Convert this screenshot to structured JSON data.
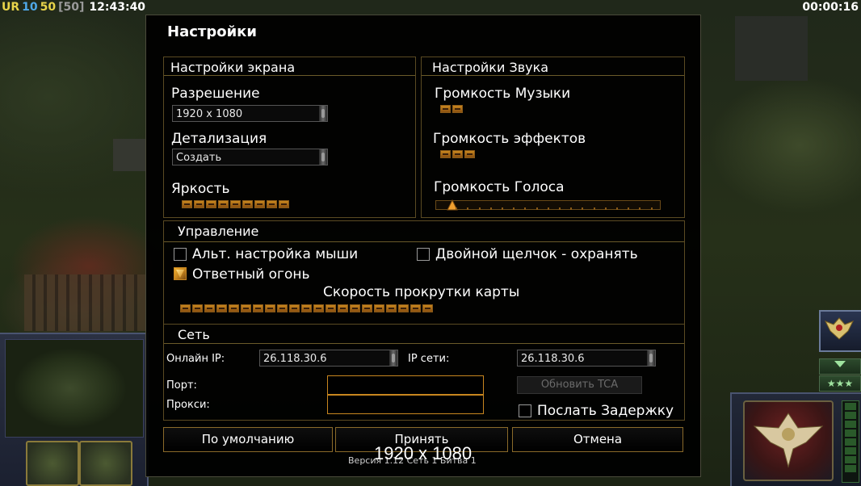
{
  "hud": {
    "ur": "UR",
    "level": "10",
    "count_a": "50",
    "count_b": "[50]",
    "clock": "12:43:40",
    "timer": "00:00:16"
  },
  "dialog": {
    "title": "Настройки",
    "screen": {
      "title": "Настройки экрана",
      "resolution_label": "Разрешение",
      "resolution_value": "1920 x 1080",
      "detail_label": "Детализация",
      "detail_value": "Создать",
      "brightness_label": "Яркость",
      "brightness_segments": 9
    },
    "sound": {
      "title": "Настройки Звука",
      "music_label": "Громкость Музыки",
      "music_segments": 2,
      "effects_label": "Громкость эффектов",
      "effects_segments": 3,
      "voice_label": "Громкость Голоса",
      "voice_level": 0.05
    },
    "controls": {
      "title": "Управление",
      "alt_mouse_label": "Альт. настройка мыши",
      "alt_mouse_checked": false,
      "double_click_label": "Двойной щелчок - охранять",
      "double_click_checked": false,
      "return_fire_label": "Ответный огонь",
      "return_fire_checked": true,
      "scroll_speed_label": "Скорость прокрутки карты",
      "scroll_speed_segments": 21
    },
    "network": {
      "title": "Сеть",
      "online_ip_label": "Онлайн IP:",
      "online_ip_value": "26.118.30.6",
      "lan_ip_label": "IP сети:",
      "lan_ip_value": "26.118.30.6",
      "port_label": "Порт:",
      "port_value": "",
      "proxy_label": "Прокси:",
      "proxy_value": "",
      "update_tca_label": "Обновить TCA",
      "send_delay_label": "Послать Задержку",
      "send_delay_checked": false
    },
    "buttons": {
      "default_label": "По умолчанию",
      "accept_label": "Принять",
      "cancel_label": "Отмена"
    },
    "version_text": "Версия 1.12 Сеть 1 Битва 1",
    "resolution_overlay": "1920 x 1080"
  },
  "colors": {
    "accent": "#c8861f",
    "frame": "#5a4a22",
    "dialog_bg": "#000000"
  }
}
